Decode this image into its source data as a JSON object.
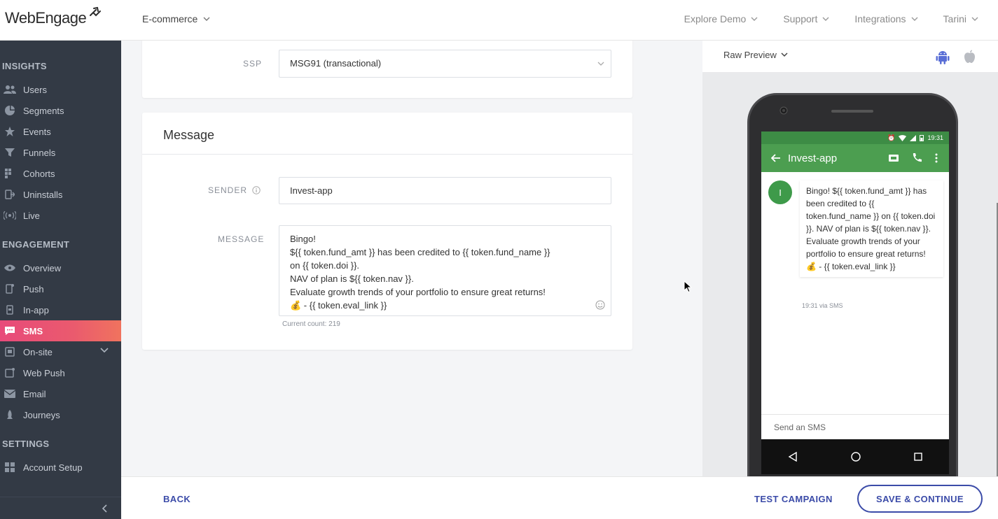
{
  "brand": {
    "logo_text": "WebEngage"
  },
  "topbar": {
    "project": "E-commerce",
    "nav": [
      "Explore Demo",
      "Support",
      "Integrations",
      "Tarini"
    ]
  },
  "sidebar": {
    "sections": [
      {
        "title": "INSIGHTS",
        "items": [
          "Users",
          "Segments",
          "Events",
          "Funnels",
          "Cohorts",
          "Uninstalls",
          "Live"
        ]
      },
      {
        "title": "ENGAGEMENT",
        "items": [
          "Overview",
          "Push",
          "In-app",
          "SMS",
          "On-site",
          "Web Push",
          "Email",
          "Journeys"
        ]
      },
      {
        "title": "SETTINGS",
        "items": [
          "Account Setup"
        ]
      }
    ],
    "active_item": "SMS"
  },
  "form": {
    "ssp_label": "SSP",
    "ssp_value": "MSG91 (transactional)",
    "message_card_title": "Message",
    "sender_label": "SENDER",
    "sender_value": "Invest-app",
    "message_label": "MESSAGE",
    "message_lines": [
      "Bingo!",
      "${{ token.fund_amt }} has been credited to {{ token.fund_name }}",
      "on {{ token.doi }}.",
      "NAV of plan is ${{ token.nav }}.",
      "Evaluate growth trends of your portfolio to ensure great returns!",
      "💰 - {{ token.eval_link }}"
    ],
    "count_text": "Current count: 219"
  },
  "preview": {
    "mode": "Raw Preview",
    "status_time": "19:31",
    "contact": "Invest-app",
    "avatar_letter": "I",
    "sms_text": "Bingo! ${{ token.fund_amt }} has been credited to {{ token.fund_name }} on {{ token.doi }}. NAV of plan is ${{ token.nav }}. Evaluate growth trends of your portfolio to ensure great returns! 💰 - {{ token.eval_link }}",
    "meta": "19:31 via SMS",
    "compose_placeholder": "Send an SMS"
  },
  "footer": {
    "back": "BACK",
    "test": "TEST CAMPAIGN",
    "save": "SAVE & CONTINUE"
  },
  "colors": {
    "sidebar_bg": "#333a45",
    "active_gradient_start": "#e84a7a",
    "active_gradient_end": "#f0735e",
    "primary_blue": "#3b4ba8",
    "android_green": "#4c9e50",
    "android_icon": "#5a6fd6"
  }
}
